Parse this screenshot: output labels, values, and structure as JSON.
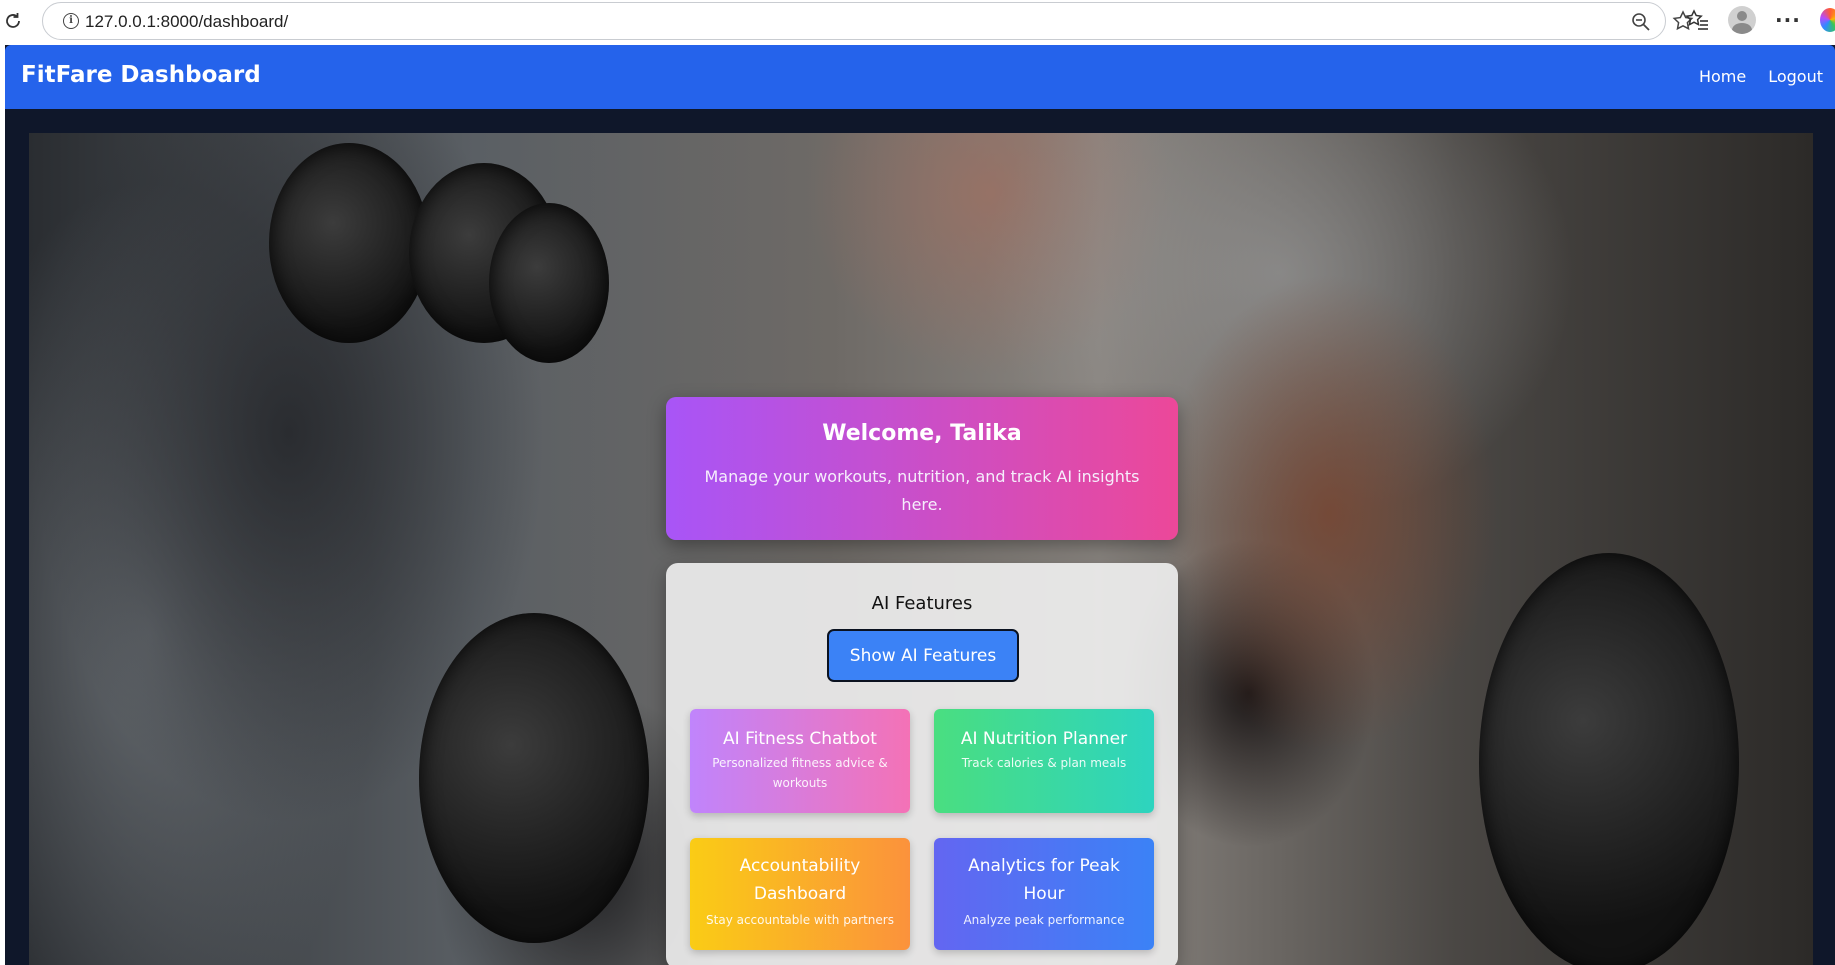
{
  "browser": {
    "url": "127.0.0.1:8000/dashboard/"
  },
  "navbar": {
    "brand": "FitFare Dashboard",
    "links": [
      "Home",
      "Logout"
    ]
  },
  "welcome": {
    "title": "Welcome, Talika",
    "subtitle": "Manage your workouts, nutrition, and track AI insights here."
  },
  "ai_features": {
    "heading": "AI Features",
    "button_label": "Show AI Features",
    "cards": [
      {
        "title": "AI Fitness Chatbot",
        "description": "Personalized fitness advice & workouts"
      },
      {
        "title": "AI Nutrition Planner",
        "description": "Track calories & plan meals"
      },
      {
        "title": "Accountability Dashboard",
        "description": "Stay accountable with partners"
      },
      {
        "title": "Analytics for Peak Hour",
        "description": "Analyze peak performance"
      }
    ]
  }
}
